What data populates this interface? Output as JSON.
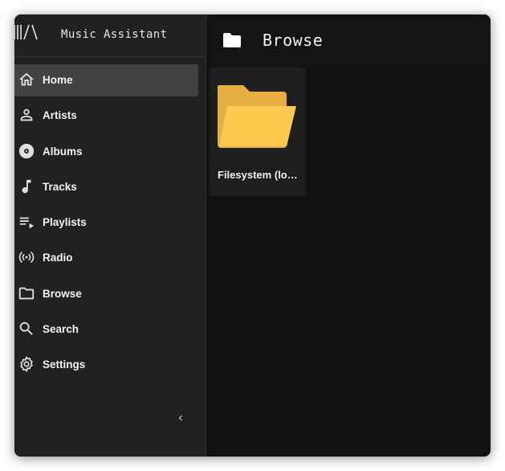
{
  "app": {
    "title": "Music Assistant"
  },
  "sidebar": {
    "items": [
      {
        "id": "home",
        "label": "Home",
        "icon": "home-icon",
        "active": true
      },
      {
        "id": "artists",
        "label": "Artists",
        "icon": "person-icon",
        "active": false
      },
      {
        "id": "albums",
        "label": "Albums",
        "icon": "disc-icon",
        "active": false
      },
      {
        "id": "tracks",
        "label": "Tracks",
        "icon": "music-note-icon",
        "active": false
      },
      {
        "id": "playlists",
        "label": "Playlists",
        "icon": "playlist-icon",
        "active": false
      },
      {
        "id": "radio",
        "label": "Radio",
        "icon": "radio-icon",
        "active": false
      },
      {
        "id": "browse",
        "label": "Browse",
        "icon": "folder-icon",
        "active": false
      },
      {
        "id": "search",
        "label": "Search",
        "icon": "search-icon",
        "active": false
      },
      {
        "id": "settings",
        "label": "Settings",
        "icon": "gear-icon",
        "active": false
      }
    ],
    "collapse_icon": "chevron-left-icon"
  },
  "main": {
    "title": "Browse",
    "title_icon": "folder-icon",
    "cards": [
      {
        "label": "Filesystem (lo…",
        "icon": "folder-open-icon"
      }
    ]
  },
  "colors": {
    "sidebar_bg": "#212121",
    "active_item_bg": "#424242",
    "main_bg": "#121212",
    "card_bg": "#1e1e1e",
    "folder_yellow": "#ffca50"
  }
}
